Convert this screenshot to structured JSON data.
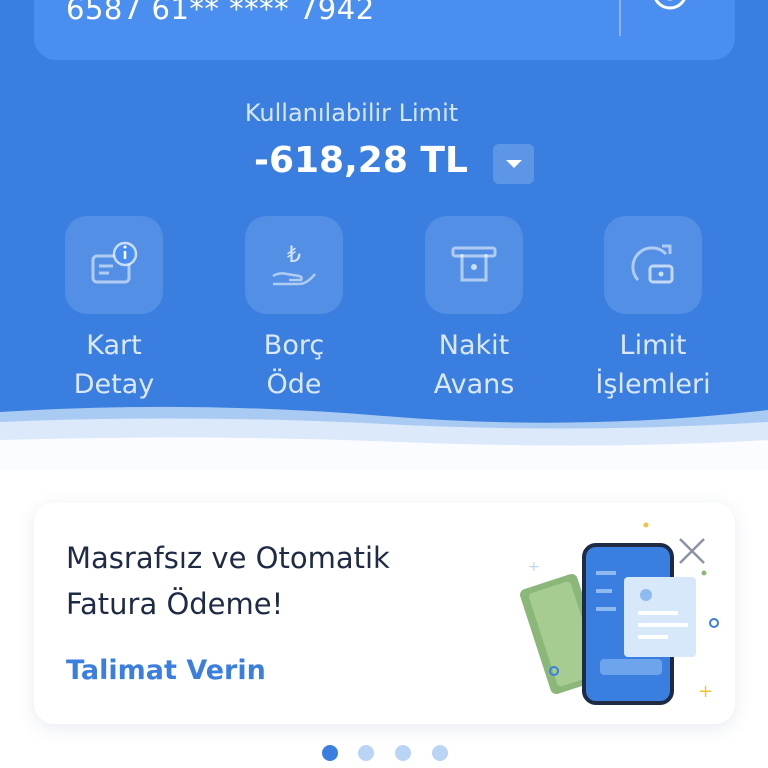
{
  "card": {
    "number": "6587 61** **** 7942",
    "icon": "card-settings-icon"
  },
  "limit": {
    "label": "Kullanılabilir Limit",
    "value": "-618,28 TL",
    "dropdown_icon": "chevron-down-icon"
  },
  "actions": [
    {
      "line1": "Kart",
      "line2": "Detay",
      "icon": "card-info-icon"
    },
    {
      "line1": "Borç",
      "line2": "Öde",
      "icon": "lira-hand-icon"
    },
    {
      "line1": "Nakit",
      "line2": "Avans",
      "icon": "atm-cash-icon"
    },
    {
      "line1": "Limit",
      "line2": "İşlemleri",
      "icon": "limit-refresh-icon"
    }
  ],
  "banner": {
    "title": "Masrafsız ve Otomatik Fatura Ödeme!",
    "link": "Talimat Verin",
    "illustration": "phone-bill-illustration",
    "close_icon": "close-icon"
  },
  "pagination": {
    "total": 4,
    "active": 1
  },
  "colors": {
    "primary": "#3a7fe0",
    "text_dark": "#1f2a44",
    "dot_inactive": "#b9d4f5"
  }
}
